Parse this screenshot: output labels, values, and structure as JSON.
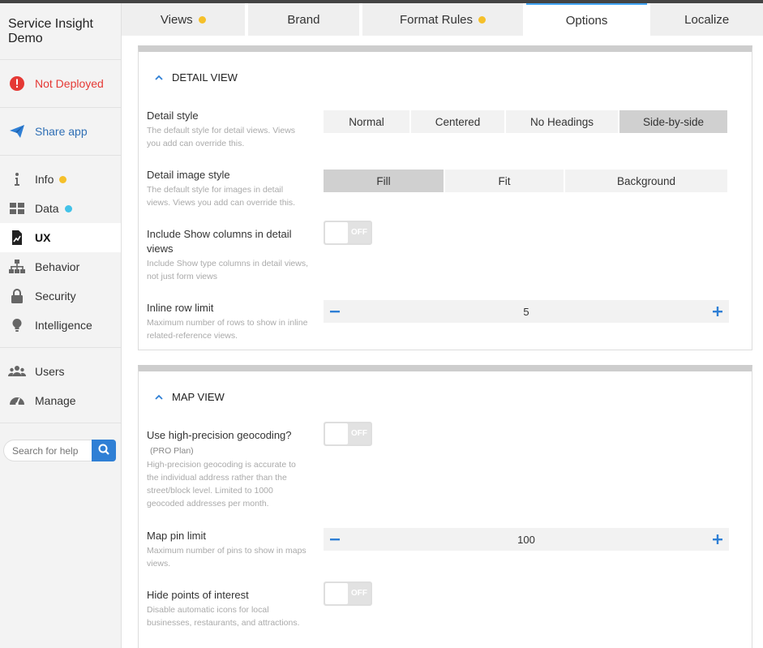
{
  "app": {
    "title": "Service Insight Demo"
  },
  "sidebar": {
    "deploy_status": "Not Deployed",
    "share": "Share app",
    "items": [
      {
        "label": "Info",
        "icon": "info-icon",
        "dot": "#f5c02a"
      },
      {
        "label": "Data",
        "icon": "grid-icon",
        "dot": "#42c2e8"
      },
      {
        "label": "UX",
        "icon": "ux-icon"
      },
      {
        "label": "Behavior",
        "icon": "sitemap-icon"
      },
      {
        "label": "Security",
        "icon": "lock-icon"
      },
      {
        "label": "Intelligence",
        "icon": "lightbulb-icon"
      }
    ],
    "items2": [
      {
        "label": "Users",
        "icon": "users-icon"
      },
      {
        "label": "Manage",
        "icon": "dashboard-icon"
      }
    ],
    "search_placeholder": "Search for help"
  },
  "tabs": [
    {
      "label": "Views",
      "dot": true
    },
    {
      "label": "Brand"
    },
    {
      "label": "Format Rules",
      "dot": true
    },
    {
      "label": "Options",
      "active": true
    },
    {
      "label": "Localize"
    }
  ],
  "detail": {
    "heading": "DETAIL VIEW",
    "style_label": "Detail style",
    "style_desc": "The default style for detail views. Views you add can override this.",
    "style_options": [
      "Normal",
      "Centered",
      "No Headings",
      "Side-by-side"
    ],
    "style_selected": "Side-by-side",
    "image_label": "Detail image style",
    "image_desc": "The default style for images in detail views. Views you add can override this.",
    "image_options": [
      "Fill",
      "Fit",
      "Background"
    ],
    "image_selected": "Fill",
    "show_label": "Include Show columns in detail views",
    "show_desc": "Include Show type columns in detail views, not just form views",
    "show_value": "OFF",
    "inline_label": "Inline row limit",
    "inline_desc": "Maximum number of rows to show in inline related-reference views.",
    "inline_value": "5"
  },
  "map": {
    "heading": "MAP VIEW",
    "geo_label": "Use high-precision geocoding?",
    "geo_plan": "(PRO Plan)",
    "geo_desc": "High-precision geocoding is accurate to the individual address rather than the street/block level. Limited to 1000 geocoded addresses per month.",
    "geo_value": "OFF",
    "pin_label": "Map pin limit",
    "pin_desc": "Maximum number of pins to show in maps views.",
    "pin_value": "100",
    "poi_label": "Hide points of interest",
    "poi_desc": "Disable automatic icons for local businesses, restaurants, and attractions.",
    "poi_value": "OFF"
  },
  "colors": {
    "accent": "#2f7fd5",
    "danger": "#e53935",
    "warn_dot": "#f5c02a",
    "info_dot": "#42c2e8"
  }
}
